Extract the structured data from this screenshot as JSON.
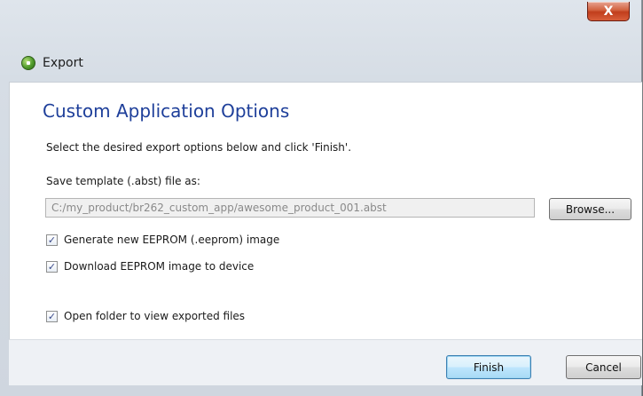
{
  "window": {
    "title": "Export",
    "close_symbol": "X"
  },
  "dialog": {
    "heading": "Custom Application Options",
    "instruction": "Select the desired export options below and click 'Finish'.",
    "save_label": "Save template (.abst) file as:",
    "path_value": "C:/my_product/br262_custom_app/awesome_product_001.abst",
    "browse_label": "Browse...",
    "options": [
      {
        "label": "Generate new EEPROM (.eeprom) image",
        "checked": true
      },
      {
        "label": "Download EEPROM image to device",
        "checked": true
      },
      {
        "label": "Open folder to view exported files",
        "checked": true
      }
    ],
    "check_mark": "✓"
  },
  "footer": {
    "finish_label": "Finish",
    "cancel_label": "Cancel"
  },
  "colors": {
    "heading": "#1e3f9a",
    "close_button": "#c13e1c",
    "default_button_border": "#3c7fb1"
  }
}
